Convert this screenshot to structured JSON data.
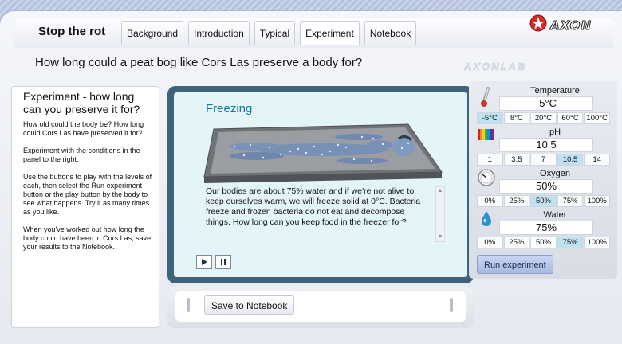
{
  "app": {
    "title": "Stop the rot",
    "logo_text": "AXON",
    "watermark": "AXONLAB"
  },
  "tabs": [
    {
      "label": "Background"
    },
    {
      "label": "Introduction"
    },
    {
      "label": "Typical"
    },
    {
      "label": "Experiment",
      "active": true
    },
    {
      "label": "Notebook"
    }
  ],
  "question": "How long could a peat bog like Cors Las preserve a body for?",
  "left_panel": {
    "title": "Experiment - how long can you preserve it for?",
    "paragraphs": [
      "How old could the body be? How long could Cors Las have preserved it for?",
      "Experiment with the conditions in the panel to the right.",
      "Use the buttons to play with the levels of each, then select the Run experiment button or the play button by the body to see what happens. Try it as many times as you like.",
      "When you've worked out how long the body could have been in Cors Las, save your results to the Notebook."
    ]
  },
  "scene": {
    "title": "Freezing",
    "description": "Our bodies are about 75% water and if we're not alive to keep ourselves warm, we will freeze solid at 0°C. Bacteria freeze and frozen bacteria do not eat and decompose things. How long can you keep food in the freezer for?",
    "scroll_up": "▲",
    "scroll_down": "▼"
  },
  "bottom": {
    "save_label": "Save to Notebook"
  },
  "controls": {
    "temperature": {
      "label": "Temperature",
      "value": "-5°C",
      "options": [
        "-5°C",
        "8°C",
        "20°C",
        "60°C",
        "100°C"
      ],
      "selected": 0,
      "icon": "thermometer-icon"
    },
    "ph": {
      "label": "pH",
      "value": "10.5",
      "options": [
        "1",
        "3.5",
        "7",
        "10.5",
        "14"
      ],
      "selected": 3,
      "icon": "ph-scale-icon"
    },
    "oxygen": {
      "label": "Oxygen",
      "value": "50%",
      "options": [
        "0%",
        "25%",
        "50%",
        "75%",
        "100%"
      ],
      "selected": 2,
      "icon": "gauge-icon"
    },
    "water": {
      "label": "Water",
      "value": "75%",
      "options": [
        "0%",
        "25%",
        "50%",
        "75%",
        "100%"
      ],
      "selected": 3,
      "icon": "water-drop-icon"
    },
    "run_label": "Run experiment"
  },
  "colors": {
    "accent_teal": "#137d95",
    "panel_dark": "#3f6378",
    "selected_option": "#bfe2f2",
    "run_button": "#a9badf"
  }
}
